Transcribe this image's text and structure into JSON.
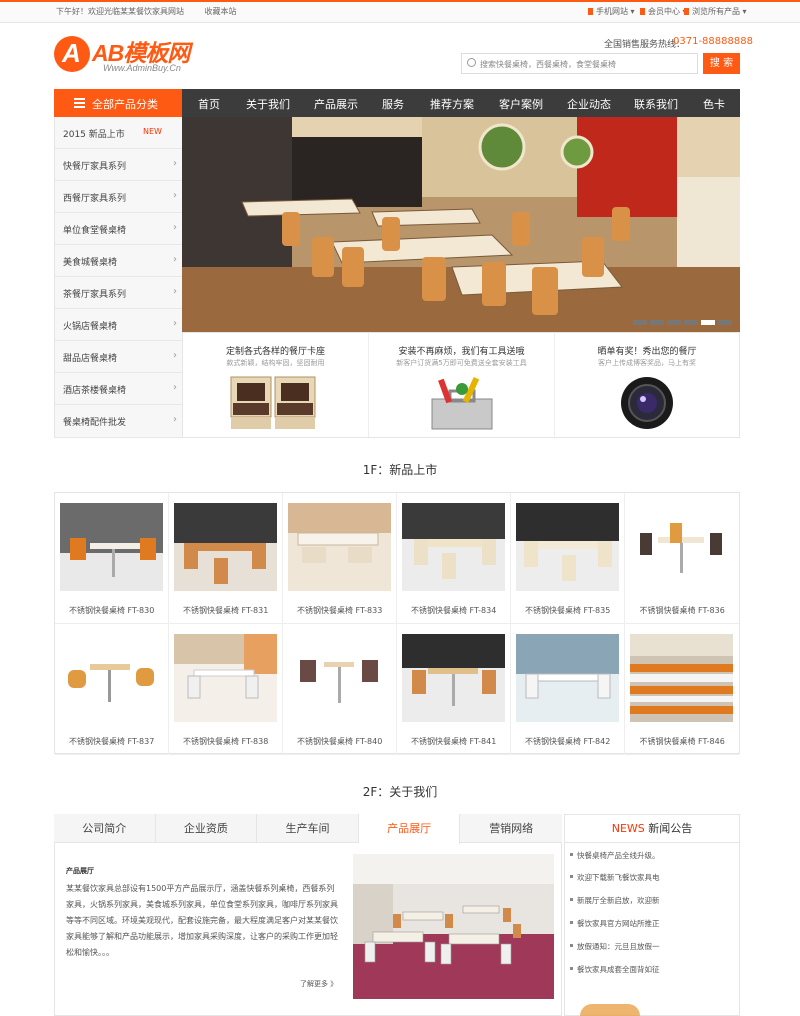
{
  "topbar": {
    "welcome": "下午好！欢迎光临某某餐饮家具网站",
    "favorite": "收藏本站",
    "mobile": "手机网站",
    "member": "会员中心",
    "browse": "浏览所有产品"
  },
  "header": {
    "logo_name": "AB模板网",
    "logo_url": "Www.AdminBuy.Cn",
    "hotline_label": "全国销售服务热线：",
    "hotline": "0371-88888888",
    "search_placeholder": "搜索快餐桌椅，西餐桌椅，食堂餐桌椅",
    "search_button": "搜 索"
  },
  "nav": {
    "category_head": "全部产品分类",
    "items": [
      "首页",
      "关于我们",
      "产品展示",
      "服务",
      "推荐方案",
      "客户案例",
      "企业动态",
      "联系我们",
      "色卡"
    ]
  },
  "categories": [
    {
      "label": "2015 新品上市",
      "badge": "NEW"
    },
    {
      "label": "快餐厅家具系列"
    },
    {
      "label": "西餐厅家具系列"
    },
    {
      "label": "单位食堂餐桌椅"
    },
    {
      "label": "美食城餐桌椅"
    },
    {
      "label": "茶餐厅家具系列"
    },
    {
      "label": "火锅店餐桌椅"
    },
    {
      "label": "甜品店餐桌椅"
    },
    {
      "label": "酒店茶楼餐桌椅"
    },
    {
      "label": "餐桌椅配件批发"
    }
  ],
  "banner": {
    "slides": 6,
    "active": 5
  },
  "features": [
    {
      "title": "定制各式各样的餐厅卡座",
      "sub": "款式新颖，结构牢固，坚固耐用"
    },
    {
      "title": "安装不再麻烦，我们有工具送哦",
      "sub": "新客户订货满5万即可免费送全套安装工具"
    },
    {
      "title": "晒单有奖！秀出您的餐厅",
      "sub": "客户上传成博客奖品，马上有奖"
    }
  ],
  "sections": {
    "new_products": "1F：新品上市",
    "about": "2F：关于我们"
  },
  "products": [
    "不锈钢快餐桌椅 FT-830",
    "不锈钢快餐桌椅 FT-831",
    "不锈钢快餐桌椅 FT-833",
    "不锈钢快餐桌椅 FT-834",
    "不锈钢快餐桌椅 FT-835",
    "不锈钢快餐桌椅 FT-836",
    "不锈钢快餐桌椅 FT-837",
    "不锈钢快餐桌椅 FT-838",
    "不锈钢快餐桌椅 FT-840",
    "不锈钢快餐桌椅 FT-841",
    "不锈钢快餐桌椅 FT-842",
    "不锈钢快餐桌椅 FT-846"
  ],
  "about": {
    "tabs": [
      "公司简介",
      "企业资质",
      "生产车间",
      "产品展厅",
      "营销网络"
    ],
    "active_tab": 3,
    "title": "产品展厅",
    "text": "某某餐饮家具总部设有1500平方产品展示厅，涵盖快餐系列桌椅，西餐系列家具，火锅系列家具，美食城系列家具，单位食堂系列家具，咖啡厅系列家具等等不同区域。环境美观现代，配套设施完备，最大程度满足客户对某某餐饮家具能够了解和产品功能展示，增加家具采购深度，让客户的采购工作更加轻松和愉快。。。",
    "more": "了解更多 》"
  },
  "news": {
    "head_en": "NEWS",
    "head_cn": "新闻公告",
    "items": [
      "快餐桌椅产品全线升级。",
      "欢迎下载新飞餐饮家具电",
      "新展厅全新启放，欢迎新",
      "餐饮家具官方网站所推正",
      "放假通知：元旦且放假一",
      "餐饮家具成套全面背如征"
    ]
  }
}
